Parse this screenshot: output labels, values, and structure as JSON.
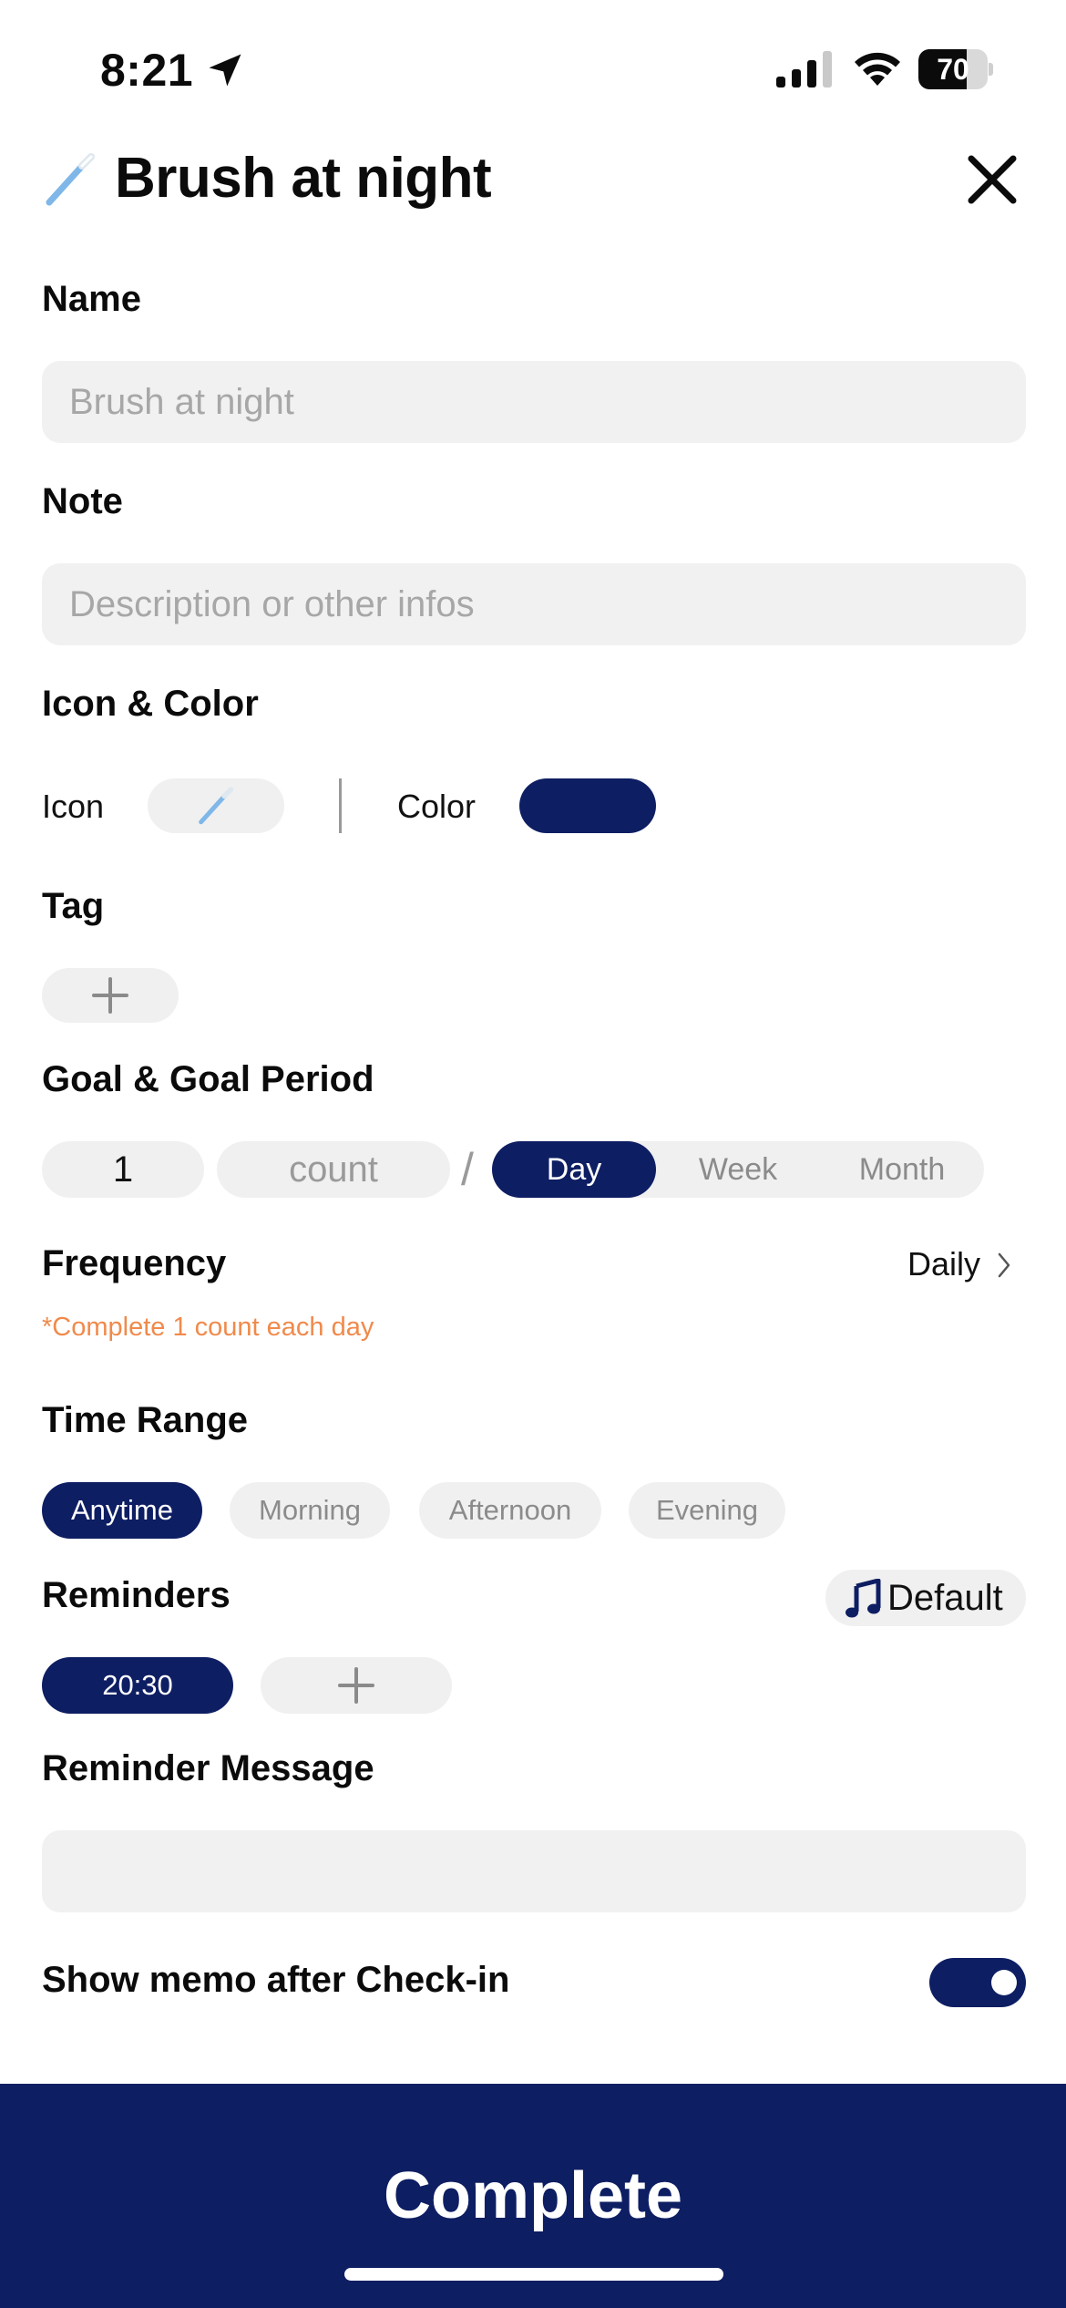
{
  "status_bar": {
    "time": "8:21",
    "battery": "70",
    "battery_level": 0.7
  },
  "header": {
    "title": "Brush at night",
    "icon": "toothbrush-icon",
    "close_icon": "close-icon"
  },
  "name_section": {
    "label": "Name",
    "value": "",
    "placeholder": "Brush at night"
  },
  "note_section": {
    "label": "Note",
    "value": "",
    "placeholder": "Description or other infos"
  },
  "icon_color_section": {
    "label": "Icon & Color",
    "icon_label": "Icon",
    "color_label": "Color",
    "selected_color": "#0e1e63"
  },
  "tag_section": {
    "label": "Tag"
  },
  "goal_section": {
    "label": "Goal & Goal Period",
    "count_value": "1",
    "unit_placeholder": "count",
    "separator": "/",
    "periods": [
      "Day",
      "Week",
      "Month"
    ],
    "selected_period": "Day"
  },
  "frequency_section": {
    "label": "Frequency",
    "value": "Daily",
    "hint": "*Complete 1 count each day",
    "hint_color": "#f08a4b"
  },
  "time_range_section": {
    "label": "Time Range",
    "options": [
      "Anytime",
      "Morning",
      "Afternoon",
      "Evening"
    ],
    "selected": "Anytime"
  },
  "reminders_section": {
    "label": "Reminders",
    "sound_label": "Default",
    "times": [
      "20:30"
    ]
  },
  "reminder_message_section": {
    "label": "Reminder Message",
    "value": "",
    "placeholder": ""
  },
  "memo_section": {
    "label": "Show memo after Check-in",
    "enabled": true
  },
  "footer": {
    "complete_label": "Complete"
  },
  "colors": {
    "accent": "#0e1e63",
    "field_bg": "#f1f1f1",
    "hint": "#f08a4b"
  }
}
